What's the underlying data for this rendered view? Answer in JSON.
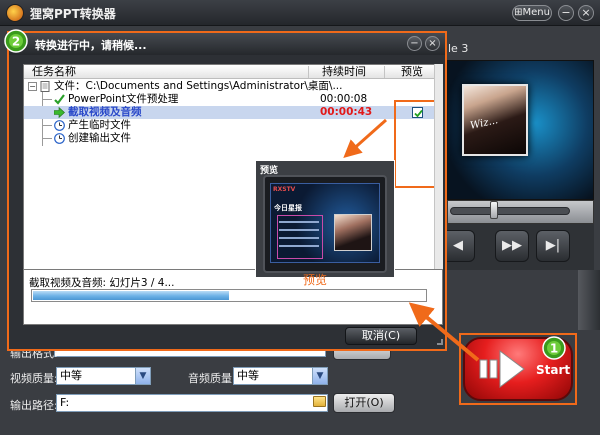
{
  "app": {
    "title": "狸窝PPT转换器",
    "menu_label": "Menu",
    "minimize_glyph": "−",
    "close_glyph": "×"
  },
  "preview": {
    "slide_label": "le 3",
    "photo_text": "Wiz...",
    "controls": [
      "◀",
      "▶▶",
      "▶|"
    ]
  },
  "dialog": {
    "badge": "2",
    "title": "转换进行中，请稍候...",
    "minimize_glyph": "−",
    "close_glyph": "×",
    "columns": {
      "task": "任务名称",
      "duration": "持续时间",
      "preview": "预览"
    },
    "rows": [
      {
        "label": "文件：C:\\Documents and Settings\\Administrator\\桌面\\...",
        "time": "",
        "icon": "document-icon"
      },
      {
        "label": "PowerPoint文件预处理",
        "time": "00:00:08",
        "icon": "check-icon"
      },
      {
        "label": "截取视频及音频",
        "time": "00:00:43",
        "icon": "arrow-right-icon",
        "selected": true,
        "checked": true
      },
      {
        "label": "产生临时文件",
        "time": "",
        "icon": "clock-icon"
      },
      {
        "label": "创建输出文件",
        "time": "",
        "icon": "clock-icon"
      }
    ],
    "popup": {
      "title": "预览",
      "screen_logo": "RXSTV",
      "screen_heading": "今日星报",
      "label": "预览"
    },
    "status_text": "截取视频及音频: 幻灯片3 / 4...",
    "progress": 0.5,
    "cancel_label": "取消(C)"
  },
  "form": {
    "video_quality_label": "视频质量:",
    "video_quality_value": "中等",
    "audio_quality_label": "音频质量:",
    "audio_quality_value": "中等",
    "output_path_label": "输出路径:",
    "output_path_value": "F:",
    "open_label": "打开(O)",
    "partial_label": "输出格式:"
  },
  "start": {
    "badge": "1",
    "label": "Start"
  },
  "colors": {
    "accent": "#f06a1a",
    "start_red": "#e61e1e",
    "progress_blue": "#4b97d4",
    "time_red": "#e21818"
  }
}
